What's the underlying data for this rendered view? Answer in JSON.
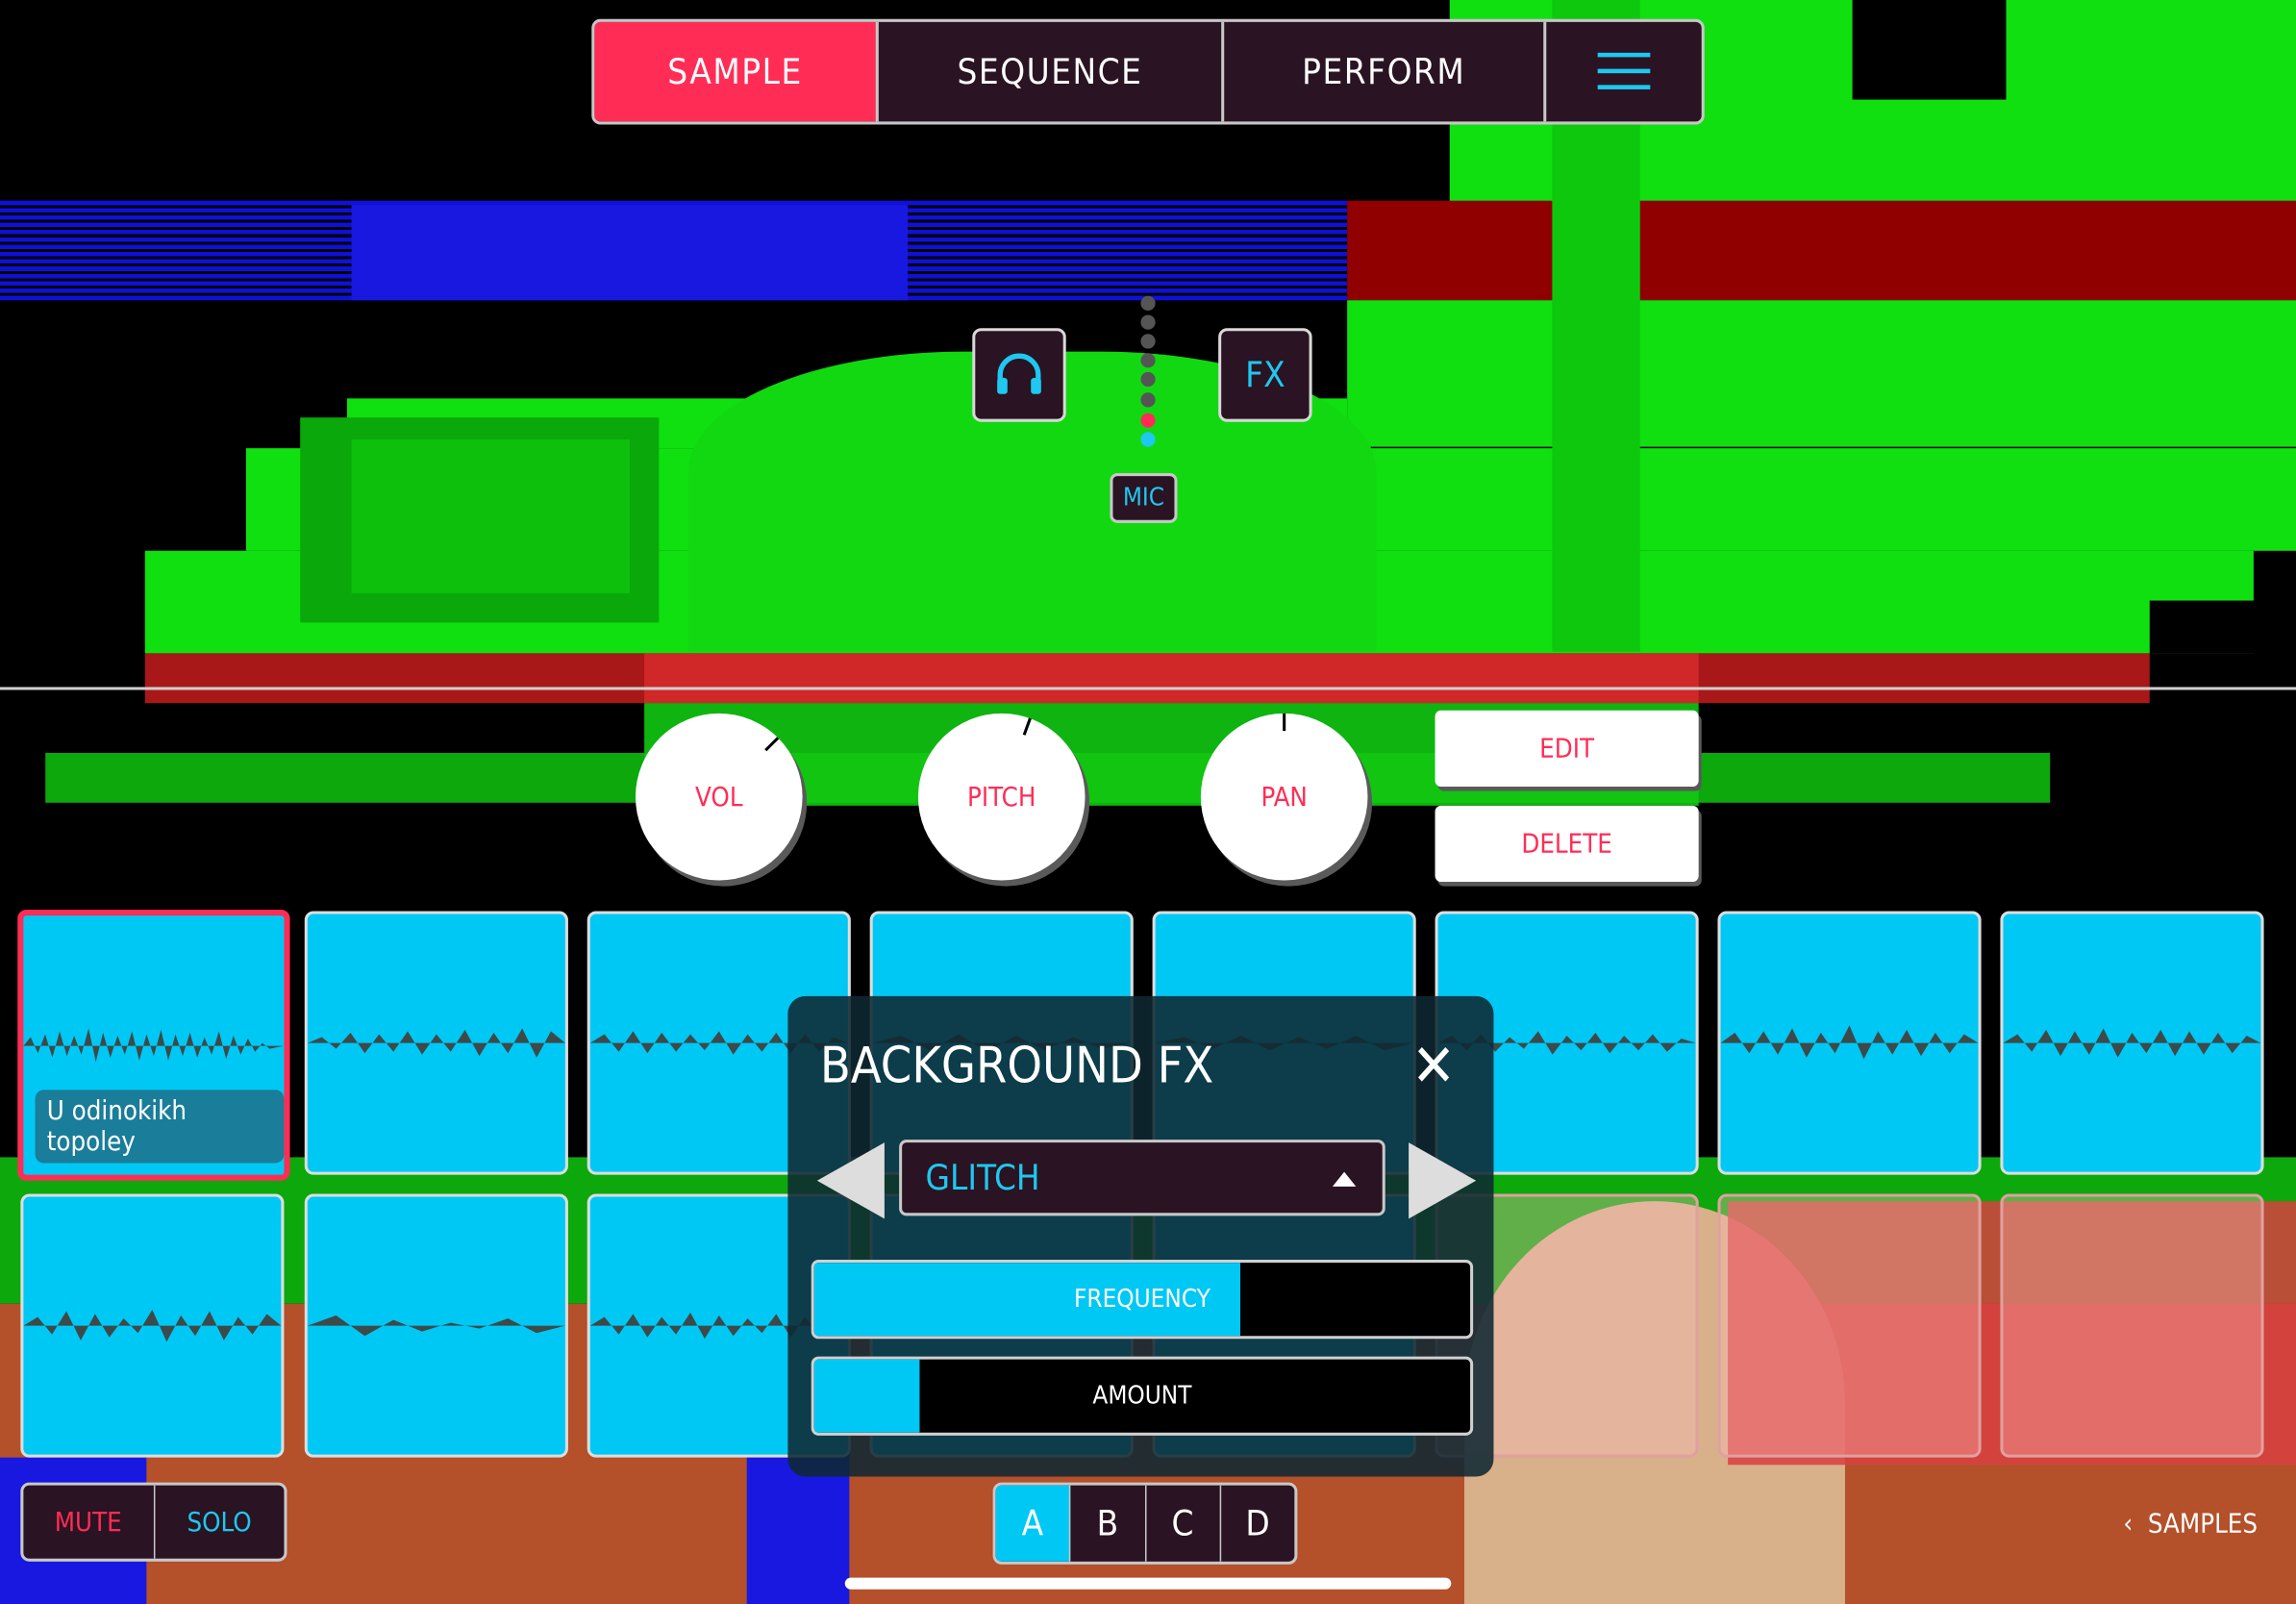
{
  "tabs": [
    {
      "label": "SAMPLE",
      "active": true
    },
    {
      "label": "SEQUENCE",
      "active": false
    },
    {
      "label": "PERFORM",
      "active": false
    }
  ],
  "menu_icon": "hamburger-icon",
  "monitor_icon": "headphones-icon",
  "fx_button_label": "FX",
  "mic_label": "MIC",
  "knobs": {
    "vol": "VOL",
    "pitch": "PITCH",
    "pan": "PAN"
  },
  "actions": {
    "edit": "EDIT",
    "delete": "DELETE"
  },
  "pads": {
    "selected_label": "U odinokikh topoley"
  },
  "mute_label": "MUTE",
  "solo_label": "SOLO",
  "banks": [
    "A",
    "B",
    "C",
    "D"
  ],
  "active_bank": "A",
  "samples_link": "SAMPLES",
  "background_fx": {
    "title": "BACKGROUND FX",
    "selected_effect": "GLITCH",
    "frequency_label": "FREQUENCY",
    "frequency_value": 0.65,
    "amount_label": "AMOUNT",
    "amount_value": 0.16
  },
  "colors": {
    "accent": "#ff2d55",
    "cyan": "#00c8f4",
    "dark": "#2a1322"
  }
}
